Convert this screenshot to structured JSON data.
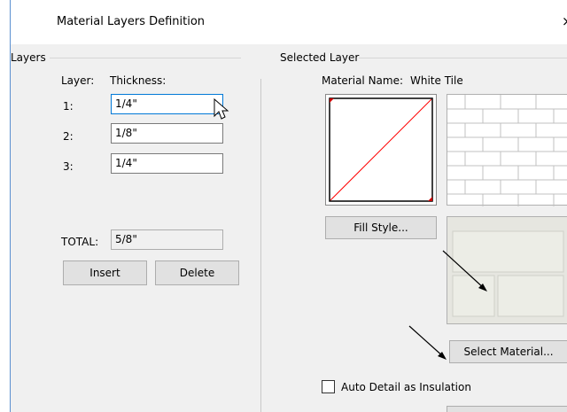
{
  "window": {
    "title": "Material Layers Definition",
    "close_glyph": "×"
  },
  "layers": {
    "group_label": "Layers",
    "col_layer": "Layer:",
    "col_thickness": "Thickness:",
    "rows": [
      {
        "num": "1:",
        "value": "1/4\""
      },
      {
        "num": "2:",
        "value": "1/8\""
      },
      {
        "num": "3:",
        "value": "1/4\""
      }
    ],
    "total_label": "TOTAL:",
    "total_value": "5/8\"",
    "insert_label": "Insert",
    "delete_label": "Delete"
  },
  "selected": {
    "group_label": "Selected Layer",
    "material_name_label": "Material Name:",
    "material_name": "White Tile",
    "fill_style_label": "Fill Style...",
    "select_material_label": "Select Material...",
    "auto_detail_label": "Auto Detail as Insulation",
    "auto_detail_checked": false
  },
  "colors": {
    "accent": "#0078d7",
    "fill_line": "#ff0000",
    "tile_bg": "#ecede6"
  }
}
